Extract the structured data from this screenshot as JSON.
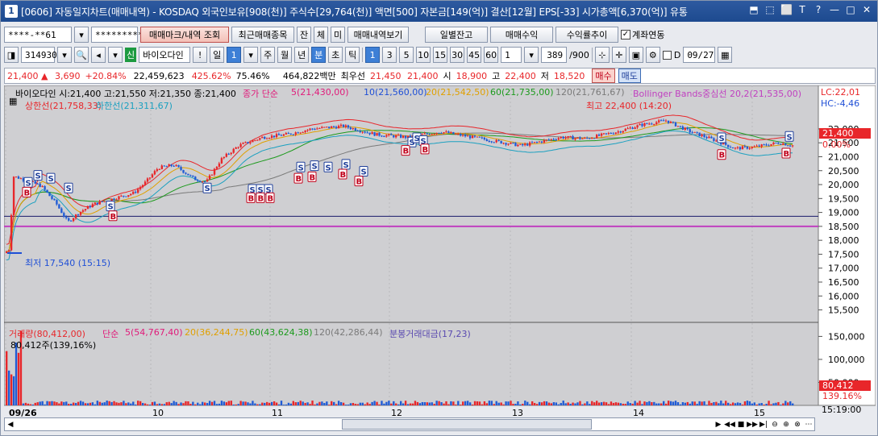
{
  "window": {
    "number": "1",
    "title": "[0606] 자동일지차트(매매내역) - KOSDAQ 외국인보유[908(천)] 주식수[29,764(천)] 액면[500] 자본금[149(억)] 결산[12월] EPS[-33] 시가총액[6,370(억)] 유통"
  },
  "title_icons": [
    "⬒",
    "⬚",
    "⬜",
    "T",
    "?",
    "—",
    "□",
    "✕"
  ],
  "toolbar1": {
    "account": "****-**61",
    "password": "*********",
    "buttons": [
      "매매마크/내역 조회",
      "최근매매종목",
      "잔",
      "체",
      "미",
      "매매내역보기"
    ],
    "right_buttons": [
      "일별잔고",
      "매매수익",
      "수익률추이"
    ],
    "checkbox": "계좌연동"
  },
  "toolbar2": {
    "code": "314930",
    "name": "바이오다인",
    "marker": "신",
    "period_buttons": [
      "일",
      "주",
      "월",
      "년",
      "분",
      "초",
      "틱"
    ],
    "active_period": "분",
    "intervals": [
      "1",
      "3",
      "5",
      "10",
      "15",
      "30",
      "45",
      "60"
    ],
    "active_interval": "1",
    "count_sel": "1",
    "count": "389",
    "total": "/900",
    "date": "09/27"
  },
  "status": {
    "price": "21,400",
    "arrow": "▲",
    "change": "3,690",
    "rate": "+20.84%",
    "volume": "22,459,623",
    "ratio": "425.62%",
    "ratio2": "75.46%",
    "amount": "464,822백만",
    "bid_label": "최우선",
    "bid1": "21,450",
    "bid2": "21,400",
    "open_label": "시",
    "open": "18,900",
    "high_label": "고",
    "high": "22,400",
    "low_label": "저",
    "low": "18,520",
    "buy": "매수",
    "sell": "매도"
  },
  "price_legend": {
    "name": "바이오다인 시:21,400 고:21,550 저:21,350 종:21,400",
    "ma_prefix": "종가 단순",
    "ma5": "5(21,430,00)",
    "ma10": "10(21,560,00)",
    "ma20": "20(21,542,50)",
    "ma60": "60(21,735,00)",
    "ma120": "120(21,761,67)",
    "bollinger": "Bollinger Bands중심선 20,2(21,535,00)",
    "upper": "상한선(21,758,33)",
    "lower": "하한선(21,311,67)",
    "high_mark": "최고 22,400 (14:20)",
    "low_mark": "최저 17,540 (15:15)",
    "lc": "LC:22,01",
    "hc": "HC:-4,46",
    "cur_price": "21,400",
    "cur_pct": "0.00%"
  },
  "price_axis": [
    "22,000",
    "21,500",
    "21,000",
    "20,500",
    "20,000",
    "19,500",
    "19,000",
    "18,500",
    "18,000",
    "17,500",
    "17,000",
    "16,500",
    "16,000",
    "15,500"
  ],
  "volume_legend": {
    "name": "거래량(80,412,00)",
    "ma_prefix": "단순",
    "ma5": "5(54,767,40)",
    "ma20": "20(36,244,75)",
    "ma60": "60(43,624,38)",
    "ma120": "120(42,286,44)",
    "amount": "분봉거래대금(17,23)",
    "current": "80,412주(139,16%)",
    "cur_vol": "80,412",
    "cur_vol_pct": "139.16%"
  },
  "volume_axis": [
    "150,000",
    "100,000",
    "50,000"
  ],
  "x_axis": [
    "09/26",
    "10",
    "11",
    "12",
    "13",
    "14",
    "15"
  ],
  "clock": "15:19:00",
  "colors": {
    "up": "#e8262a",
    "down": "#1f5bd6",
    "ma5": "#e01b7a",
    "ma10": "#1f4fd6",
    "ma20": "#e0a000",
    "ma60": "#1c9a1c",
    "ma120": "#7a7a7a",
    "bb": "#c040c0"
  }
}
